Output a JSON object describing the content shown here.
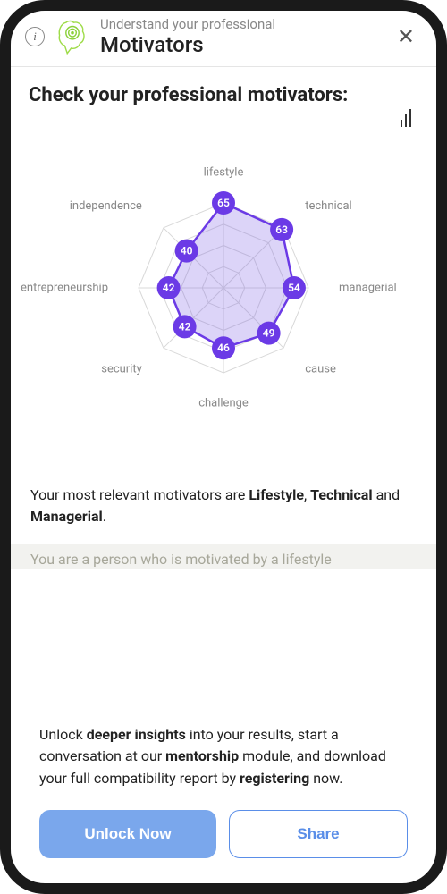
{
  "header": {
    "subtitle": "Understand your professional",
    "title": "Motivators"
  },
  "section_title": "Check your professional motivators:",
  "chart_data": {
    "type": "radar",
    "max": 65,
    "rings": 4,
    "categories": [
      "lifestyle",
      "technical",
      "managerial",
      "cause",
      "challenge",
      "security",
      "entrepreneurship",
      "independence"
    ],
    "values": [
      65,
      63,
      54,
      49,
      46,
      42,
      42,
      40
    ],
    "point_color": "#6b3ae6",
    "fill_color": "rgba(130,100,230,0.28)",
    "stroke_color": "#6b3ae6",
    "grid_color": "#d8d8d8"
  },
  "summary_parts": {
    "prefix": "Your most relevant motivators are ",
    "b1": "Lifestyle",
    "sep1": ", ",
    "b2": "Technical",
    "sep2": " and ",
    "b3": "Managerial",
    "suffix": "."
  },
  "teaser": "You are a person who is motivated by a lifestyle",
  "unlock": {
    "t1": "Unlock ",
    "b1": "deeper insights",
    "t2": " into your results, start a conversation at our ",
    "b2": "mentorship",
    "t3": " module, and download your full compatibility report by ",
    "b3": "registering",
    "t4": " now."
  },
  "buttons": {
    "primary": "Unlock Now",
    "secondary": "Share"
  }
}
